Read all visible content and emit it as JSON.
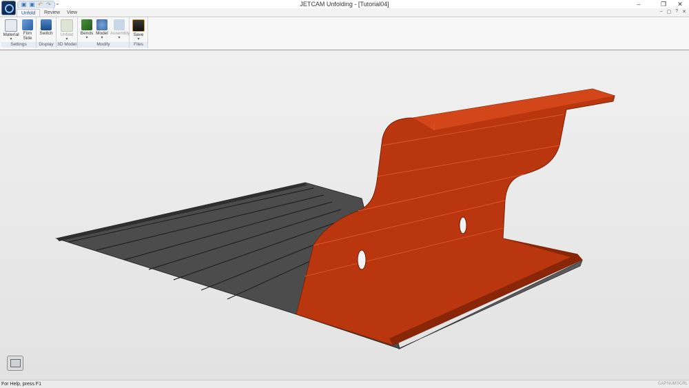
{
  "window": {
    "title": "JETCAM Unfolding - [Tutorial04]",
    "controls": [
      "–",
      "❐",
      "✕"
    ]
  },
  "qat": {
    "items": [
      "▣",
      "▣",
      "↶",
      "↷"
    ],
    "menu": "⌄"
  },
  "tabs": [
    "Unfold",
    "Review",
    "View"
  ],
  "help_cluster": [
    "–",
    "▢",
    "?",
    "✕"
  ],
  "ribbon": {
    "groups": [
      {
        "label": "Settings",
        "buttons": [
          {
            "label1": "Material",
            "label2": "▾",
            "icon": "material-icon"
          },
          {
            "label1": "Film",
            "label2": "Side",
            "icon": "film-side-icon"
          }
        ]
      },
      {
        "label": "Display",
        "buttons": [
          {
            "label1": "Switch",
            "label2": "",
            "icon": "switch-icon"
          }
        ]
      },
      {
        "label": "3D Model",
        "buttons": [
          {
            "label1": "Unfold",
            "label2": "▾",
            "icon": "unfold-icon"
          }
        ]
      },
      {
        "label": "Modify",
        "buttons": [
          {
            "label1": "Bends",
            "label2": "▾",
            "icon": "bends-icon"
          },
          {
            "label1": "Model",
            "label2": "▾",
            "icon": "model-icon"
          },
          {
            "label1": "Assembly",
            "label2": "▾",
            "icon": "assembly-icon"
          }
        ]
      },
      {
        "label": "Files",
        "buttons": [
          {
            "label1": "Save",
            "label2": "▾",
            "icon": "save-icon"
          }
        ]
      }
    ]
  },
  "colors": {
    "part": "#b9360f",
    "part_light": "#d2461a",
    "part_dark": "#8a2608",
    "flat": "#4c4c4c",
    "flat_dark": "#2c2c2c"
  },
  "status": {
    "text": "For Help, press F1",
    "indicators": [
      "CAP",
      "NUM",
      "SCRL"
    ]
  }
}
